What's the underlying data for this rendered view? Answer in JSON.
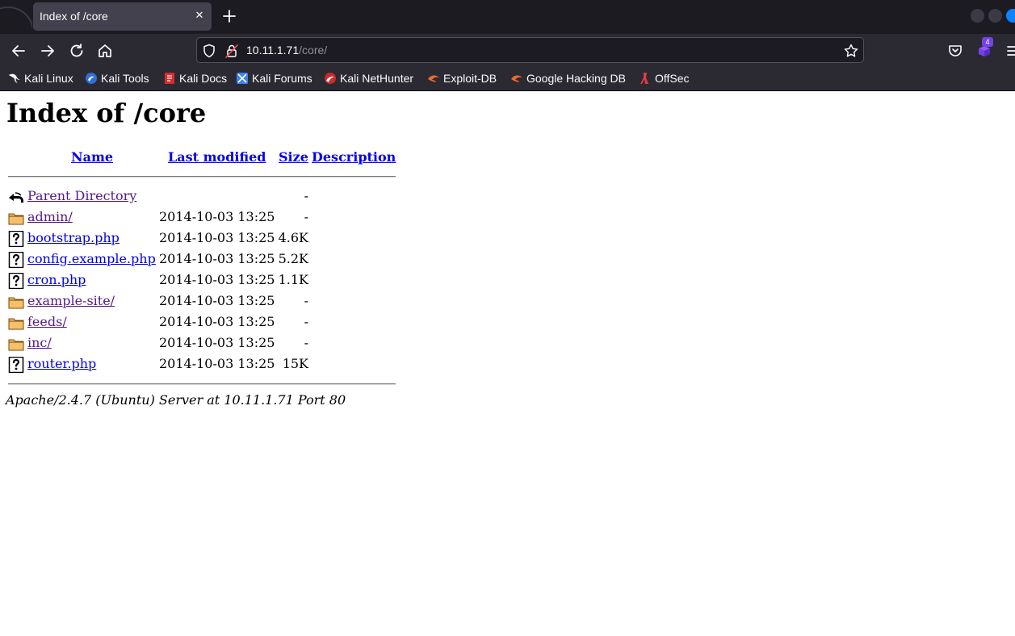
{
  "browser": {
    "tab_title": "Index of /core",
    "tab_close": "✕",
    "url_host": "10.11.1.71",
    "url_path": "/core/",
    "extension_badge": "4",
    "accent_color": "#0a84ff"
  },
  "bookmarks": [
    {
      "label": "Kali Linux",
      "icon": "kali-dragon-icon"
    },
    {
      "label": "Kali Tools",
      "icon": "kali-tools-icon"
    },
    {
      "label": "Kali Docs",
      "icon": "kali-docs-icon"
    },
    {
      "label": "Kali Forums",
      "icon": "kali-forums-icon"
    },
    {
      "label": "Kali NetHunter",
      "icon": "kali-nethunter-icon"
    },
    {
      "label": "Exploit-DB",
      "icon": "exploit-db-icon"
    },
    {
      "label": "Google Hacking DB",
      "icon": "ghdb-icon"
    },
    {
      "label": "OffSec",
      "icon": "offsec-icon"
    }
  ],
  "page": {
    "title": "Index of /core",
    "columns": {
      "name": "Name",
      "last_modified": "Last modified",
      "size": "Size",
      "description": "Description"
    },
    "rows": [
      {
        "name": "Parent Directory",
        "modified": "",
        "size": "-",
        "type": "back",
        "visited": true
      },
      {
        "name": "admin/",
        "modified": "2014-10-03 13:25",
        "size": "-",
        "type": "folder",
        "visited": true
      },
      {
        "name": "bootstrap.php",
        "modified": "2014-10-03 13:25",
        "size": "4.6K",
        "type": "file",
        "visited": false
      },
      {
        "name": "config.example.php",
        "modified": "2014-10-03 13:25",
        "size": "5.2K",
        "type": "file",
        "visited": false
      },
      {
        "name": "cron.php",
        "modified": "2014-10-03 13:25",
        "size": "1.1K",
        "type": "file",
        "visited": false
      },
      {
        "name": "example-site/",
        "modified": "2014-10-03 13:25",
        "size": "-",
        "type": "folder",
        "visited": true
      },
      {
        "name": "feeds/",
        "modified": "2014-10-03 13:25",
        "size": "-",
        "type": "folder",
        "visited": true
      },
      {
        "name": "inc/",
        "modified": "2014-10-03 13:25",
        "size": "-",
        "type": "folder",
        "visited": true
      },
      {
        "name": "router.php",
        "modified": "2014-10-03 13:25",
        "size": "15K",
        "type": "file",
        "visited": false
      }
    ],
    "server_signature": "Apache/2.4.7 (Ubuntu) Server at 10.11.1.71 Port 80"
  }
}
